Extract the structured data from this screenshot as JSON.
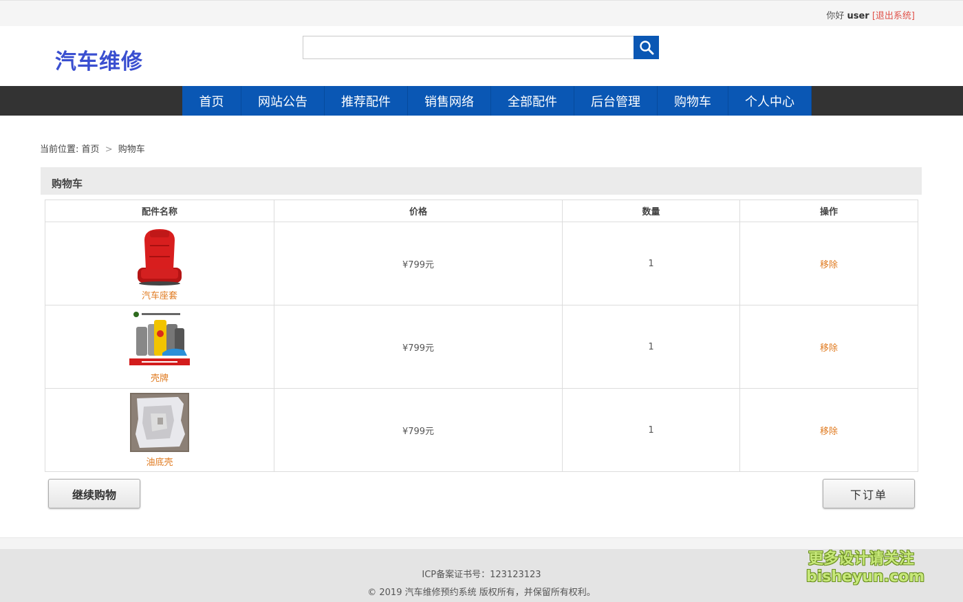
{
  "topbar": {
    "greeting": "你好",
    "username": "user",
    "logout": "[退出系统]"
  },
  "header": {
    "logo": "汽车维修",
    "search_placeholder": "",
    "search_value": ""
  },
  "nav": {
    "items": [
      {
        "label": "首页"
      },
      {
        "label": "网站公告"
      },
      {
        "label": "推荐配件"
      },
      {
        "label": "销售网络"
      },
      {
        "label": "全部配件"
      },
      {
        "label": "后台管理"
      },
      {
        "label": "购物车"
      },
      {
        "label": "个人中心"
      }
    ]
  },
  "breadcrumb": {
    "prefix": "当前位置:",
    "home": "首页",
    "separator": ">",
    "current": "购物车"
  },
  "cart": {
    "title": "购物车",
    "columns": [
      "配件名称",
      "价格",
      "数量",
      "操作"
    ],
    "rows": [
      {
        "name": "汽车座套",
        "price": "¥799元",
        "qty": "1",
        "action": "移除",
        "image": "car-seat"
      },
      {
        "name": "壳牌",
        "price": "¥799元",
        "qty": "1",
        "action": "移除",
        "image": "oil-bottles"
      },
      {
        "name": "油底壳",
        "price": "¥799元",
        "qty": "1",
        "action": "移除",
        "image": "oil-pan"
      }
    ]
  },
  "buttons": {
    "continue": "继续购物",
    "order": "下订单"
  },
  "footer": {
    "icp": "ICP备案证书号：123123123",
    "copyright": "© 2019 汽车维修预约系统 版权所有，并保留所有权利。"
  },
  "watermark": {
    "line1": "更多设计请关注",
    "line2": "bisheyun.com"
  },
  "colors": {
    "primary": "#0a57b4",
    "navbar": "#333333",
    "link": "#e07a1f",
    "logout": "#e0524a"
  }
}
